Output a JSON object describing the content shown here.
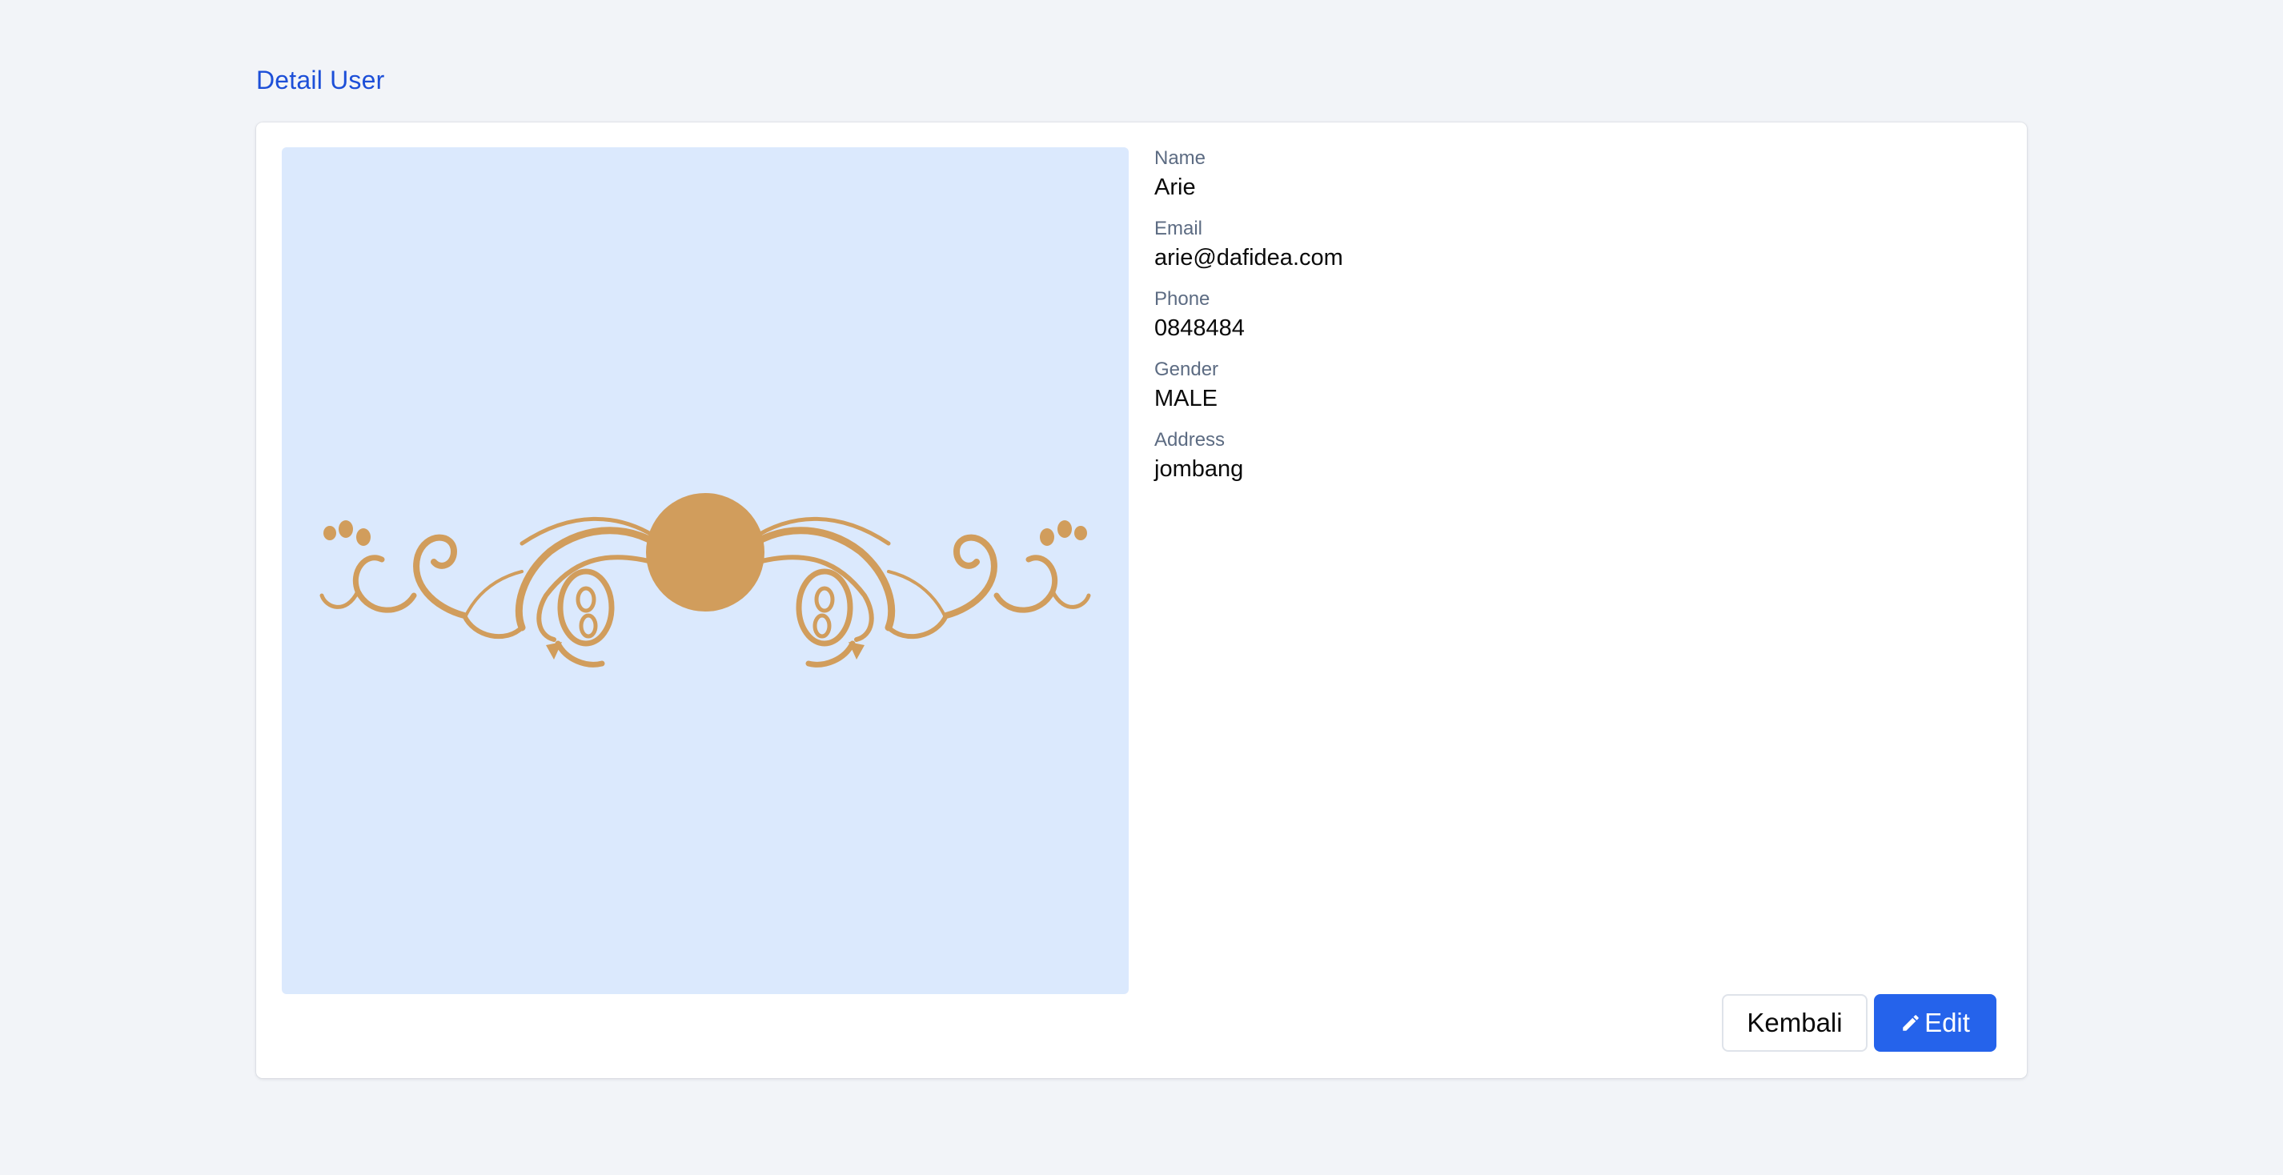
{
  "page": {
    "title": "Detail User"
  },
  "user": {
    "photo_icon": "ornament-image",
    "fields": [
      {
        "label": "Name",
        "value": "Arie"
      },
      {
        "label": "Email",
        "value": "arie@dafidea.com"
      },
      {
        "label": "Phone",
        "value": "0848484"
      },
      {
        "label": "Gender",
        "value": "MALE"
      },
      {
        "label": "Address",
        "value": "jombang"
      }
    ]
  },
  "actions": {
    "back_label": "Kembali",
    "edit_label": "Edit",
    "edit_icon": "pencil-icon"
  },
  "colors": {
    "background": "#f2f4f8",
    "title": "#1d4fd8",
    "photo_bg": "#dbe9fd",
    "ornament": "#d19d5c",
    "primary": "#2563eb"
  }
}
